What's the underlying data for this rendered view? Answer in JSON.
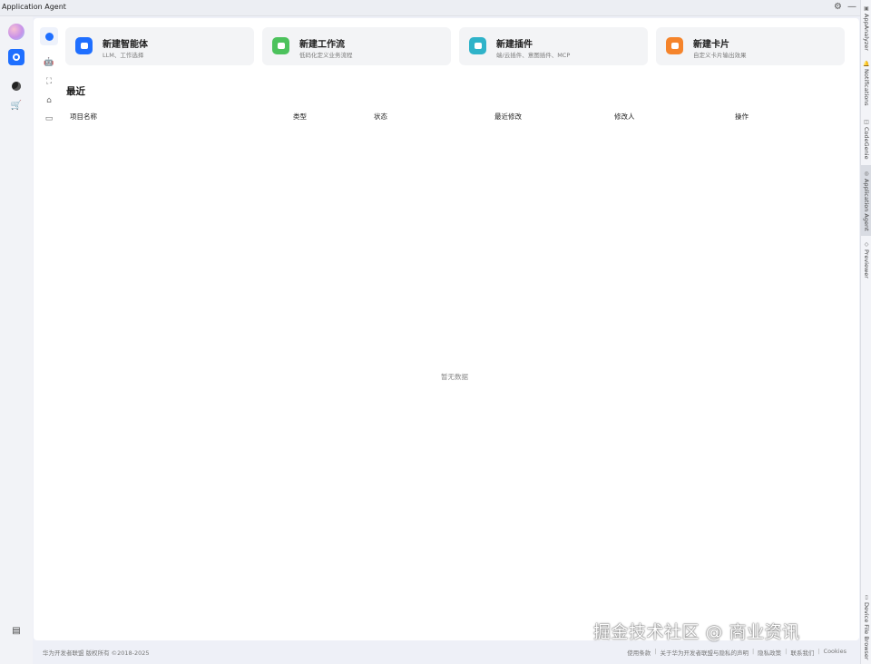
{
  "window": {
    "title": "Application Agent"
  },
  "titlebar_icons": [
    "gear-icon",
    "minimize-icon"
  ],
  "right_tabs": [
    {
      "label": "AppAnalyzer",
      "icon": "analyzer-icon"
    },
    {
      "label": "Notifications",
      "icon": "bell-icon"
    },
    {
      "label": "CodeGenie",
      "icon": "codegenie-icon"
    },
    {
      "label": "Application Agent",
      "icon": "agent-icon",
      "active": true
    },
    {
      "label": "Previewer",
      "icon": "previewer-icon"
    },
    {
      "label": "Device File Browser",
      "icon": "device-icon"
    }
  ],
  "cards": [
    {
      "title": "新建智能体",
      "subtitle": "LLM、工作选择",
      "color": "#1f6fff"
    },
    {
      "title": "新建工作流",
      "subtitle": "低码化定义业务流程",
      "color": "#4cc25c"
    },
    {
      "title": "新建插件",
      "subtitle": "端/云插件、意图插件、MCP",
      "color": "#2fb3c9"
    },
    {
      "title": "新建卡片",
      "subtitle": "自定义卡片输出效果",
      "color": "#f5842b"
    }
  ],
  "recent": {
    "title": "最近",
    "columns": [
      "项目名称",
      "类型",
      "状态",
      "最近修改",
      "修改人",
      "操作"
    ],
    "empty_text": "暂无数据"
  },
  "footer": {
    "copyright": "华为开发者联盟 版权所有 ©2018-2025",
    "links": [
      "使用条款",
      "关于华为开发者联盟与隐私的声明",
      "隐私政策",
      "联系我们",
      "Cookies"
    ]
  },
  "watermark": "掘金技术社区 @ 商业资讯"
}
